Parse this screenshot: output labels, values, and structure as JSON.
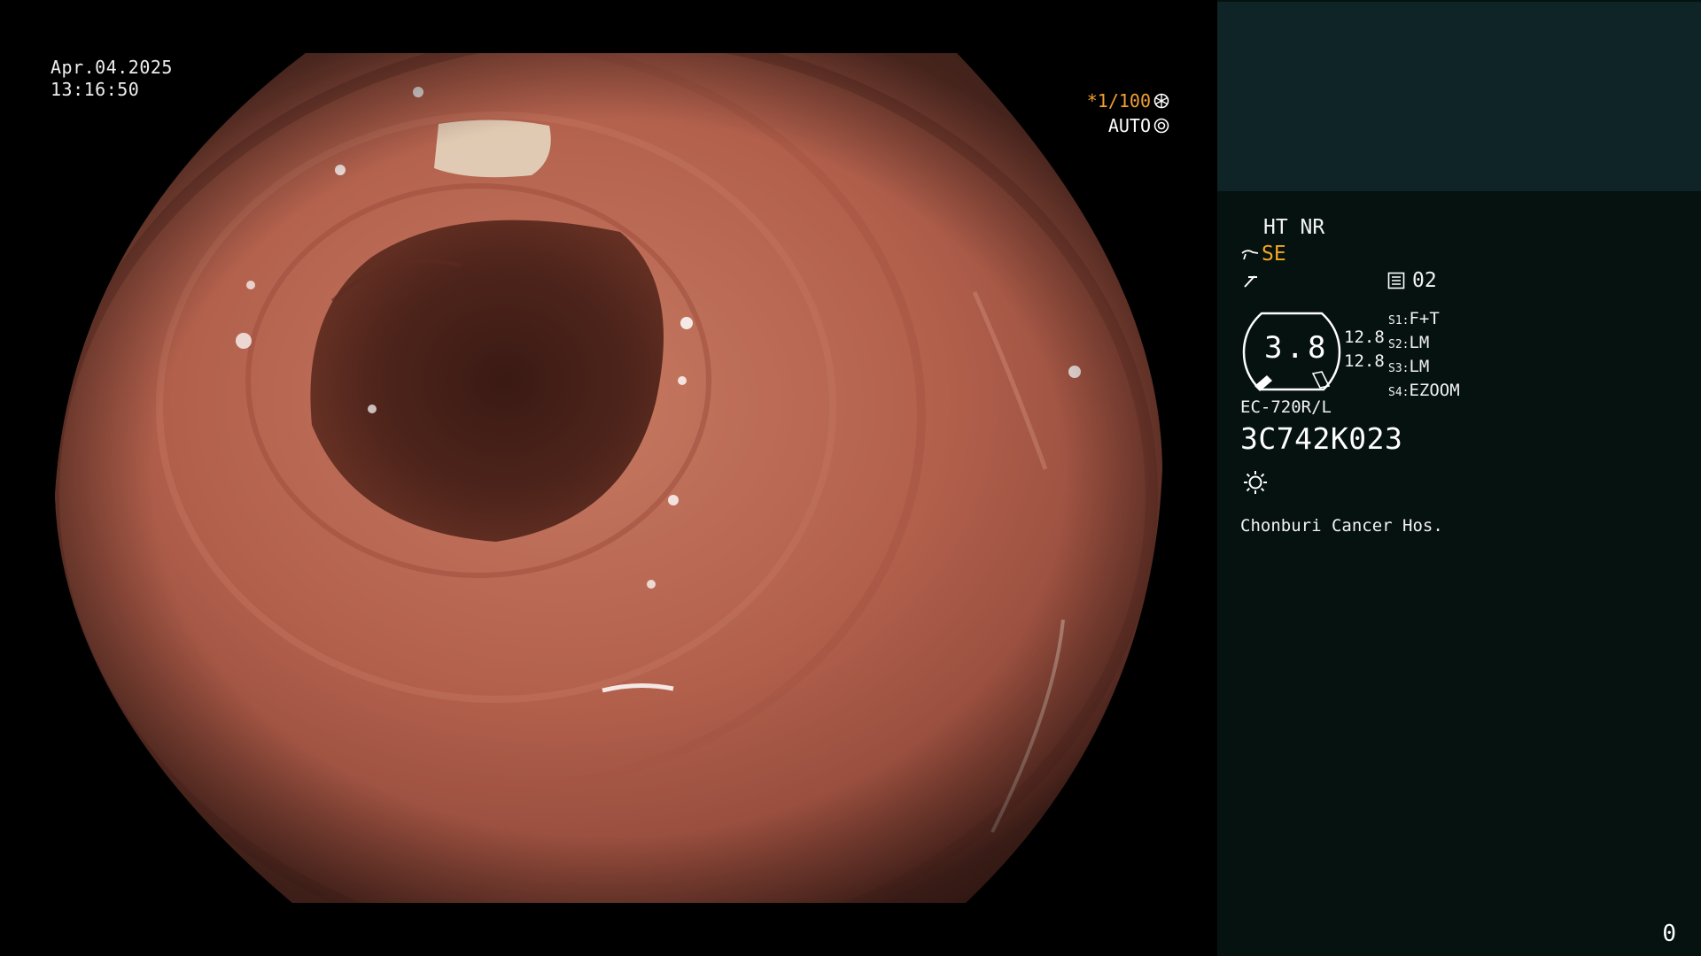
{
  "overlay": {
    "date": "Apr.04.2025",
    "time": "13:16:50",
    "shutter_label": "*1/100",
    "iris_label": "AUTO"
  },
  "panel": {
    "mode_line": "HT NR",
    "se_label": "SE",
    "channel_label": "02",
    "gauge_value": "3.8",
    "gauge_left": "12.8",
    "gauge_right": "12.8",
    "switches": [
      {
        "key": "S1:",
        "value": "F+T"
      },
      {
        "key": "S2:",
        "value": "LM"
      },
      {
        "key": "S3:",
        "value": "LM"
      },
      {
        "key": "S4:",
        "value": "EZOOM"
      }
    ],
    "scope_model": "EC-720R/L",
    "serial": "3C742K023",
    "hospital": "Chonburi Cancer Hos.",
    "page_number": "0"
  },
  "colors": {
    "panel_bg": "#051210",
    "panel_top_bg": "#0e2426",
    "accent_orange": "#f5a623",
    "mucosa": "#b0604e"
  },
  "icons": [
    "shutter-icon",
    "iris-icon",
    "se-icon",
    "freeze-icon",
    "memory-icon",
    "light-icon"
  ]
}
